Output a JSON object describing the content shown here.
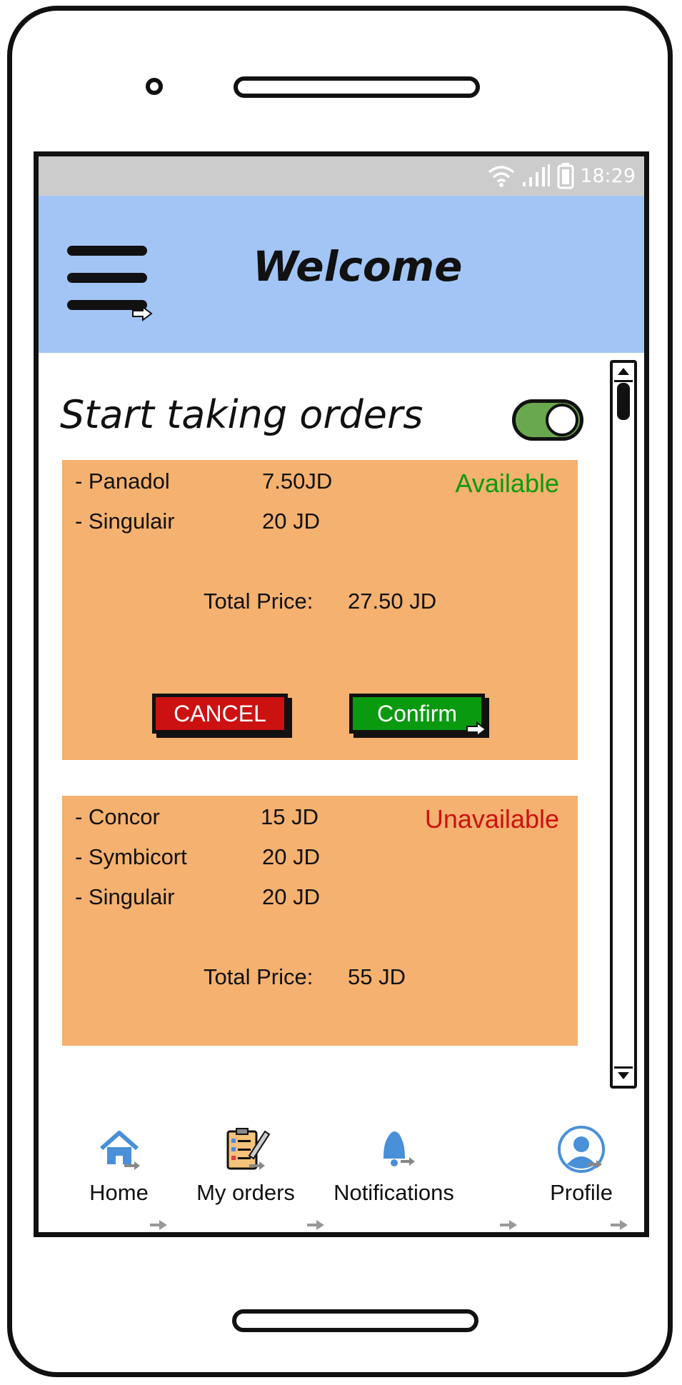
{
  "status_bar": {
    "time": "18:29"
  },
  "app_bar": {
    "title": "Welcome"
  },
  "toggle": {
    "label": "Start taking orders",
    "on": true
  },
  "orders": [
    {
      "status": "Available",
      "status_color": "#0a9a10",
      "items": [
        {
          "name": "- Panadol",
          "price": "7.50JD"
        },
        {
          "name": "- Singulair",
          "price": "20 JD"
        }
      ],
      "total_label": "Total Price:",
      "total_value": "27.50 JD",
      "cancel_label": "CANCEL",
      "confirm_label": "Confirm"
    },
    {
      "status": "Unavailable",
      "status_color": "#cc1111",
      "items": [
        {
          "name": "- Concor",
          "price": "15 JD"
        },
        {
          "name": "- Symbicort",
          "price": "20 JD"
        },
        {
          "name": "- Singulair",
          "price": "20 JD"
        }
      ],
      "total_label": "Total Price:",
      "total_value": "55 JD"
    }
  ],
  "nav": [
    {
      "label": "Home",
      "icon": "home-icon"
    },
    {
      "label": "My orders",
      "icon": "clipboard-icon"
    },
    {
      "label": "Notifications",
      "icon": "bell-icon"
    },
    {
      "label": "Profile",
      "icon": "user-icon"
    }
  ],
  "colors": {
    "app_bar": "#a2c5f6",
    "card": "#f4b16f",
    "toggle_on": "#6aa84f"
  }
}
